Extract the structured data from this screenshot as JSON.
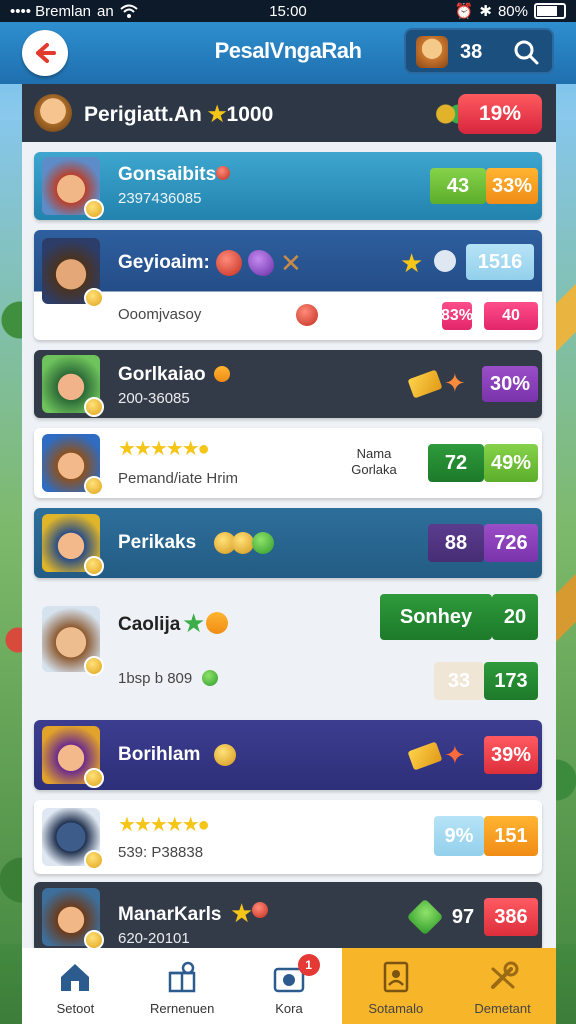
{
  "status_bar": {
    "carrier": "•••• Bremlan",
    "network": "an",
    "time": "15:00",
    "battery": "80%"
  },
  "header": {
    "title": "PesalVngaRah",
    "coins": "38"
  },
  "player": {
    "name": "Perigiatt.An",
    "star": "★",
    "score": "1000",
    "badge": "19%"
  },
  "rows": [
    {
      "name": "Gonsaibits",
      "sub": "2397436085",
      "stat1": "43",
      "stat2": "33%"
    },
    {
      "name": "Geyioaim:",
      "sub": "Ooomjvasoy",
      "stat1": "1516",
      "stat2": "83%",
      "stat3": "40"
    },
    {
      "name": "Gorlkaiao",
      "sub": "200-36085",
      "stat2": "30%"
    },
    {
      "name": "Pemand/iate Hrim",
      "note1": "Nama",
      "note2": "Gorlaka",
      "stat1": "72",
      "stat2": "49%"
    },
    {
      "name": "Perikaks",
      "stat1": "88",
      "stat2": "726"
    },
    {
      "name": "Caolija",
      "sub": "1bsp b 809",
      "stat1": "Sonhey",
      "stat1b": "20",
      "stat2": "33",
      "stat3": "173"
    },
    {
      "name": "Borihlam",
      "stat2": "39%"
    },
    {
      "name": "539: P38838",
      "stat1": "9%",
      "stat2": "151"
    },
    {
      "name": "ManarKarls",
      "sub": "620-20101",
      "stat1": "97",
      "stat2": "386"
    }
  ],
  "nav": [
    {
      "label": "Setoot",
      "icon": "home-icon"
    },
    {
      "label": "Rernenuen",
      "icon": "gift-icon"
    },
    {
      "label": "Kora",
      "icon": "camera-icon",
      "badge": "1"
    },
    {
      "label": "Sotamalo",
      "icon": "card-icon"
    },
    {
      "label": "Demetant",
      "icon": "tools-icon"
    }
  ],
  "colors": {
    "accent": "#f7b529",
    "header": "#2e8fcf",
    "danger": "#dc2f3b"
  }
}
